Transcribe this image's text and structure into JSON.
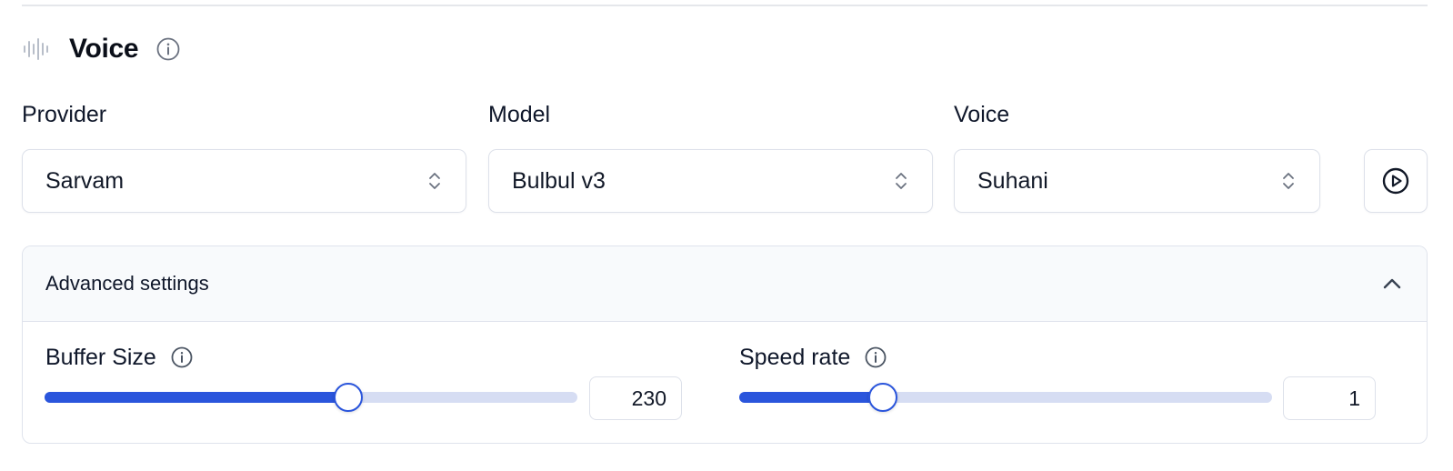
{
  "section": {
    "title": "Voice",
    "icon": "sound-wave-icon",
    "info_icon": "info-icon"
  },
  "fields": {
    "provider": {
      "label": "Provider",
      "value": "Sarvam"
    },
    "model": {
      "label": "Model",
      "value": "Bulbul v3"
    },
    "voice": {
      "label": "Voice",
      "value": "Suhani"
    }
  },
  "play_button": {
    "icon": "play-circle-icon"
  },
  "advanced": {
    "title": "Advanced settings",
    "expanded": true,
    "buffer_size": {
      "label": "Buffer Size",
      "value": "230",
      "fill_fraction": 0.57
    },
    "speed_rate": {
      "label": "Speed rate",
      "value": "1",
      "fill_fraction": 0.27
    }
  },
  "colors": {
    "accent": "#2a55dc",
    "track": "#d6ddf3",
    "border": "#dde1ea",
    "header_bg": "#f8fafc"
  }
}
